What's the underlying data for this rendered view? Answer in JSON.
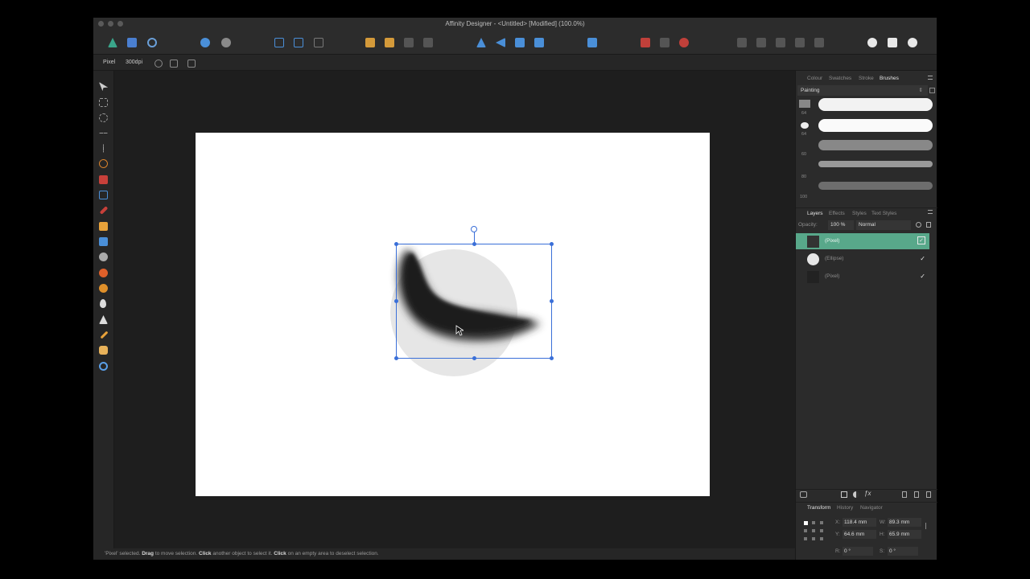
{
  "window": {
    "title": "Affinity Designer - <Untitled> [Modified] (100.0%)"
  },
  "toolbar": {
    "persona_icons": [
      "designer-persona-icon",
      "pixel-persona-icon",
      "export-persona-icon"
    ]
  },
  "context_toolbar": {
    "mode": "Pixel",
    "dpi": "300dpi"
  },
  "status": {
    "prefix": "'Pixel' selected. ",
    "drag": "Drag",
    "drag_text": " to move selection. ",
    "click1": "Click",
    "click1_text": " another object to select it. ",
    "click2": "Click",
    "click2_text": " on an empty area to deselect selection."
  },
  "brushes_panel": {
    "tabs": [
      "Colour",
      "Swatches",
      "Stroke",
      "Brushes"
    ],
    "active_tab": "Brushes",
    "category": "Painting",
    "sizes": [
      "64",
      "64",
      "60",
      "80",
      "100"
    ]
  },
  "layers_panel": {
    "tabs": [
      "Layers",
      "Effects",
      "Styles",
      "Text Styles"
    ],
    "active_tab": "Layers",
    "opacity_label": "Opacity:",
    "opacity_value": "100 %",
    "blend_mode": "Normal",
    "layers": [
      {
        "name": "(Pixel)",
        "selected": true,
        "visible": true
      },
      {
        "name": "(Ellipse)",
        "selected": false,
        "visible": true
      },
      {
        "name": "(Pixel)",
        "selected": false,
        "visible": true
      }
    ]
  },
  "transform_panel": {
    "tabs": [
      "Transform",
      "History",
      "Navigator"
    ],
    "active_tab": "Transform",
    "x_label": "X:",
    "x": "118.4 mm",
    "y_label": "Y:",
    "y": "64.6 mm",
    "w_label": "W:",
    "w": "89.3 mm",
    "h_label": "H:",
    "h": "65.9 mm",
    "r_label": "R:",
    "r": "0 °",
    "s_label": "S:",
    "s": "0 °"
  },
  "colors": {
    "accent": "#58a88a",
    "selection": "#3a6fd8",
    "panel_bg": "#2b2b2b"
  }
}
